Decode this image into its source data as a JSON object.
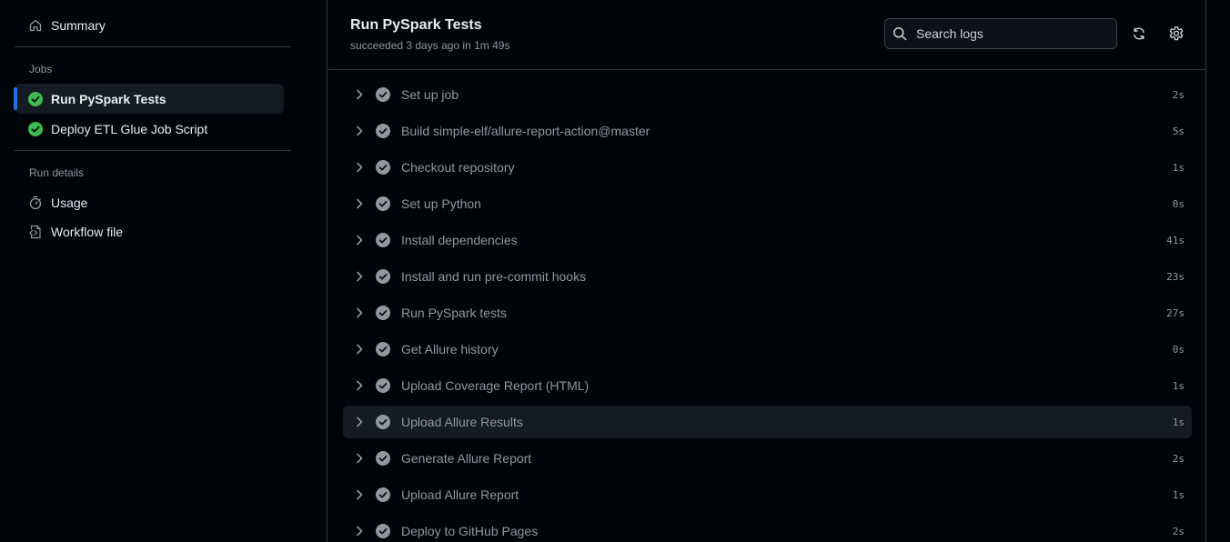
{
  "colors": {
    "background": "#010409",
    "border": "#30363d",
    "success_green": "#3fb950",
    "accent_blue": "#1f6feb",
    "muted_text": "#9198a1",
    "step_check": "#9198a1"
  },
  "sidebar": {
    "summary": {
      "label": "Summary",
      "icon": "home-icon"
    },
    "jobs_heading": "Jobs",
    "jobs": [
      {
        "label": "Run PySpark Tests",
        "status": "success",
        "active": true
      },
      {
        "label": "Deploy ETL Glue Job Script",
        "status": "success",
        "active": false
      }
    ],
    "run_details_heading": "Run details",
    "run_details": [
      {
        "label": "Usage",
        "icon": "stopwatch-icon"
      },
      {
        "label": "Workflow file",
        "icon": "file-code-icon"
      }
    ]
  },
  "header": {
    "title": "Run PySpark Tests",
    "subtitle": "succeeded 3 days ago in 1m 49s",
    "search_placeholder": "Search logs",
    "refresh_icon": "refresh-icon",
    "settings_icon": "gear-icon"
  },
  "steps": [
    {
      "name": "Set up job",
      "duration": "2s"
    },
    {
      "name": "Build simple-elf/allure-report-action@master",
      "duration": "5s"
    },
    {
      "name": "Checkout repository",
      "duration": "1s"
    },
    {
      "name": "Set up Python",
      "duration": "0s"
    },
    {
      "name": "Install dependencies",
      "duration": "41s"
    },
    {
      "name": "Install and run pre-commit hooks",
      "duration": "23s"
    },
    {
      "name": "Run PySpark tests",
      "duration": "27s"
    },
    {
      "name": "Get Allure history",
      "duration": "0s"
    },
    {
      "name": "Upload Coverage Report (HTML)",
      "duration": "1s"
    },
    {
      "name": "Upload Allure Results",
      "duration": "1s",
      "highlighted": true
    },
    {
      "name": "Generate Allure Report",
      "duration": "2s"
    },
    {
      "name": "Upload Allure Report",
      "duration": "1s"
    },
    {
      "name": "Deploy to GitHub Pages",
      "duration": "2s"
    }
  ]
}
